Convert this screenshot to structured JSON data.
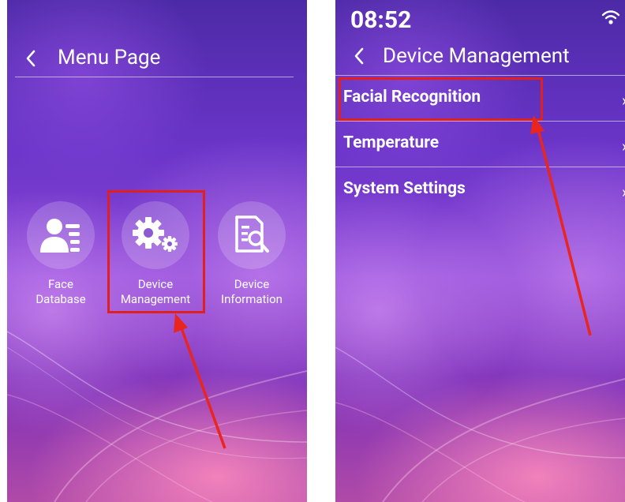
{
  "menu_page": {
    "title": "Menu Page",
    "tiles": [
      {
        "line1": "Face",
        "line2": "Database"
      },
      {
        "line1": "Device",
        "line2": "Management"
      },
      {
        "line1": "Device",
        "line2": "Information"
      }
    ]
  },
  "device_management": {
    "status_time": "08:52",
    "title": "Device Management",
    "items": [
      {
        "label": "Facial Recognition"
      },
      {
        "label": "Temperature"
      },
      {
        "label": "System Settings"
      }
    ]
  },
  "colors": {
    "highlight": "#e0201f",
    "arrow": "#e8251f",
    "text": "#ffffff"
  },
  "icons": {
    "back": "chevron-left-icon",
    "face_database": "user-list-icon",
    "device_management": "gears-icon",
    "device_information": "document-search-icon",
    "wifi": "wifi-icon",
    "row_arrow": "chevron-right-icon"
  }
}
